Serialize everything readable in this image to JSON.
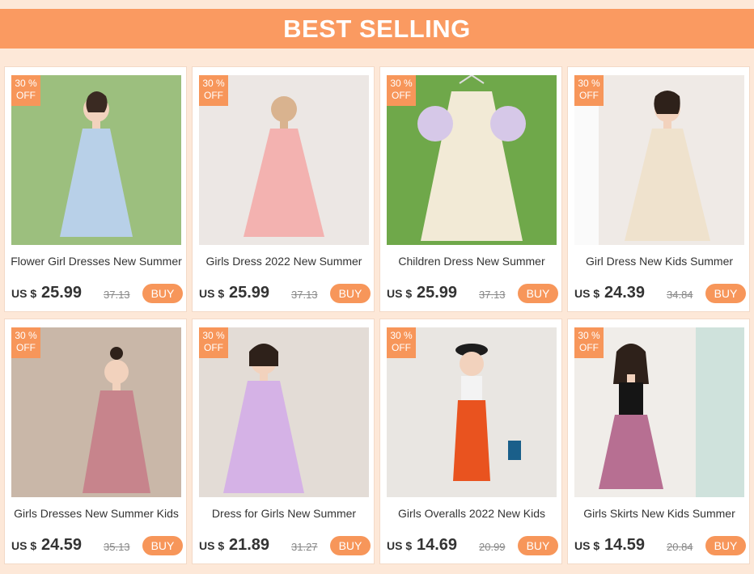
{
  "banner": {
    "title": "BEST SELLING"
  },
  "products": [
    {
      "title": "Flower Girl Dresses New Summer",
      "badge": "30 % OFF",
      "currency": "US $",
      "price": "25.99",
      "old_price": "37.13",
      "buy": "BUY",
      "bg": "#9cbf7e",
      "dress": "#b8d0e8"
    },
    {
      "title": "Girls Dress 2022 New Summer",
      "badge": "30 % OFF",
      "currency": "US $",
      "price": "25.99",
      "old_price": "37.13",
      "buy": "BUY",
      "bg": "#ece7e4",
      "dress": "#f3b2b0"
    },
    {
      "title": "Children Dress New Summer",
      "badge": "30 % OFF",
      "currency": "US $",
      "price": "25.99",
      "old_price": "37.13",
      "buy": "BUY",
      "bg": "#6fa84a",
      "dress": "#f2ead6"
    },
    {
      "title": "Girl Dress New Kids Summer",
      "badge": "30 % OFF",
      "currency": "US $",
      "price": "24.39",
      "old_price": "34.84",
      "buy": "BUY",
      "bg": "#efeae6",
      "dress": "#efe2cd"
    },
    {
      "title": "Girls Dresses New Summer Kids",
      "badge": "30 % OFF",
      "currency": "US $",
      "price": "24.59",
      "old_price": "35.13",
      "buy": "BUY",
      "bg": "#c9b7a8",
      "dress": "#c7848c"
    },
    {
      "title": "Dress for Girls New Summer",
      "badge": "30 % OFF",
      "currency": "US $",
      "price": "21.89",
      "old_price": "31.27",
      "buy": "BUY",
      "bg": "#e3dcd6",
      "dress": "#d5b2e6"
    },
    {
      "title": "Girls Overalls 2022 New Kids",
      "badge": "30 % OFF",
      "currency": "US $",
      "price": "14.69",
      "old_price": "20.99",
      "buy": "BUY",
      "bg": "#e9e6e2",
      "dress": "#e9531f"
    },
    {
      "title": "Girls Skirts New Kids Summer",
      "badge": "30 % OFF",
      "currency": "US $",
      "price": "14.59",
      "old_price": "20.84",
      "buy": "BUY",
      "bg": "#f0ede9",
      "dress": "#b76f92"
    }
  ]
}
